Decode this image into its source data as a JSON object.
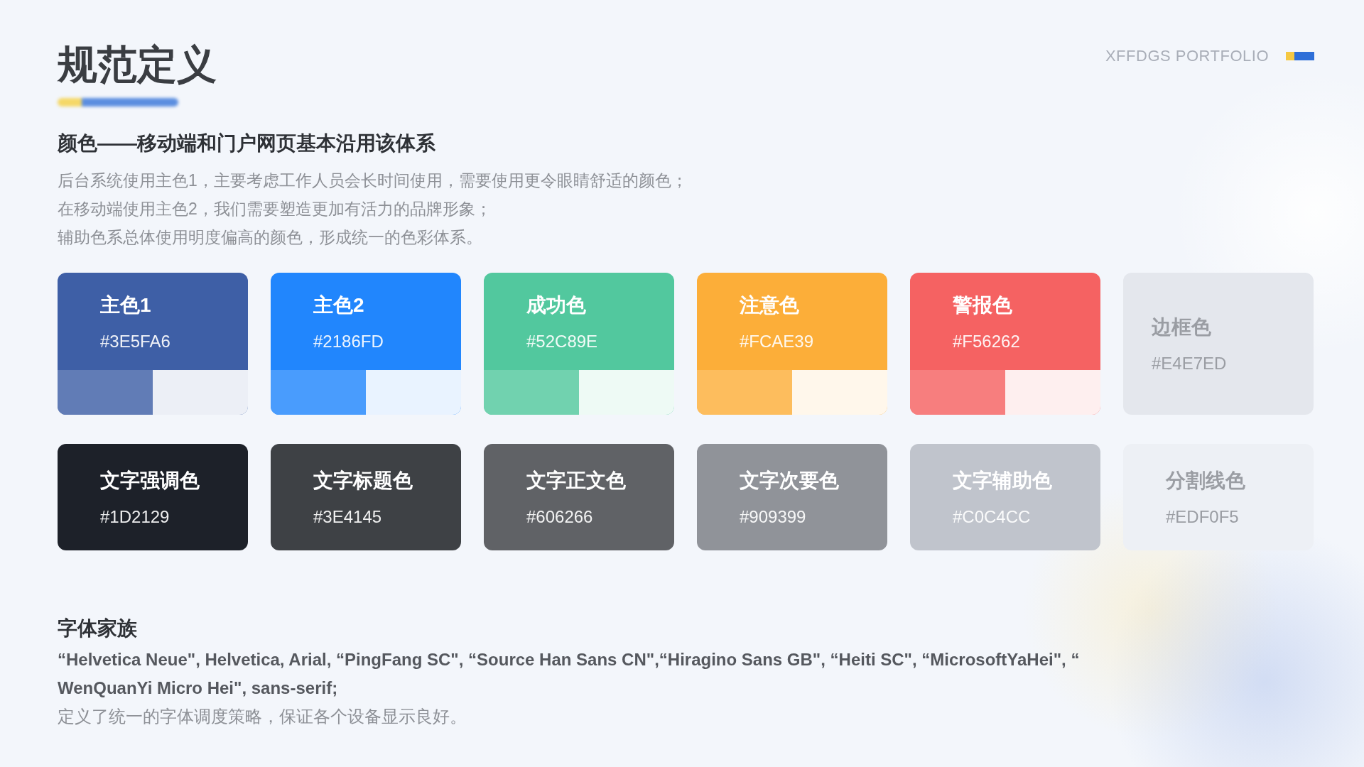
{
  "header": {
    "title": "规范定义",
    "brand": "XFFDGS PORTFOLIO"
  },
  "color_section": {
    "heading": "颜色——移动端和门户网页基本沿用该体系",
    "description": [
      "后台系统使用主色1，主要考虑工作人员会长时间使用，需要使用更令眼睛舒适的颜色；",
      "在移动端使用主色2，我们需要塑造更加有活力的品牌形象；",
      "辅助色系总体使用明度偏高的颜色，形成统一的色彩体系。"
    ],
    "rows": [
      [
        {
          "kind": "tinted",
          "name": "主色1",
          "hex": "#3E5FA6",
          "color": "#3e5fa6"
        },
        {
          "kind": "tinted",
          "name": "主色2",
          "hex": "#2186FD",
          "color": "#2186fd"
        },
        {
          "kind": "tinted",
          "name": "成功色",
          "hex": "#52C89E",
          "color": "#52c89e"
        },
        {
          "kind": "tinted",
          "name": "注意色",
          "hex": "#FCAE39",
          "color": "#fcae39"
        },
        {
          "kind": "tinted",
          "name": "警报色",
          "hex": "#F56262",
          "color": "#f56262"
        },
        {
          "kind": "pale",
          "name": "边框色",
          "hex": "#E4E7ED",
          "color": "#e4e7ed"
        }
      ],
      [
        {
          "kind": "plain",
          "name": "文字强调色",
          "hex": "#1D2129",
          "color": "#1d2129"
        },
        {
          "kind": "plain",
          "name": "文字标题色",
          "hex": "#3E4145",
          "color": "#3e4145"
        },
        {
          "kind": "plain",
          "name": "文字正文色",
          "hex": "#606266",
          "color": "#606266"
        },
        {
          "kind": "plain",
          "name": "文字次要色",
          "hex": "#909399",
          "color": "#909399"
        },
        {
          "kind": "plain",
          "name": "文字辅助色",
          "hex": "#C0C4CC",
          "color": "#c0c4cc"
        },
        {
          "kind": "pale",
          "name": "分割线色",
          "hex": "#EDF0F5",
          "color": "#edf0f5"
        }
      ]
    ]
  },
  "font_section": {
    "heading": "字体家族",
    "font_stack": [
      "“Helvetica Neue\", Helvetica, Arial, “PingFang SC\", “Source Han Sans CN\",“Hiragino Sans GB\", “Heiti SC\", “MicrosoftYaHei\", “",
      "WenQuanYi Micro Hei\", sans-serif;"
    ],
    "note": "定义了统一的字体调度策略，保证各个设备显示良好。"
  }
}
